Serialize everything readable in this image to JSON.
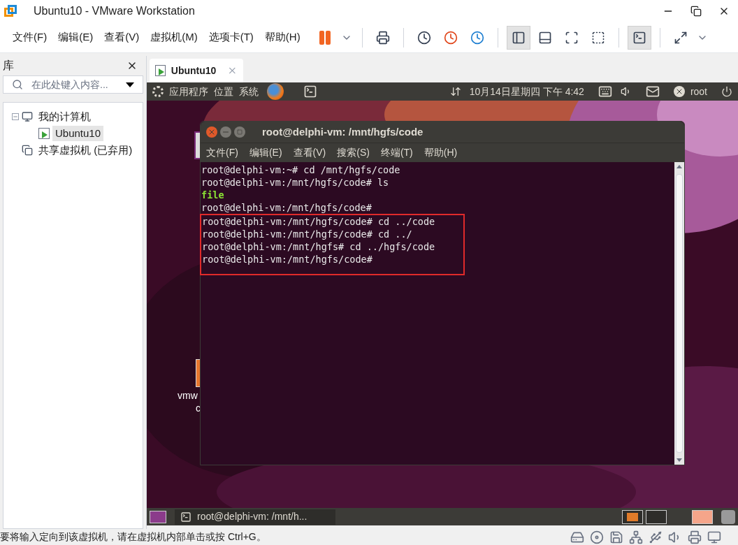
{
  "window": {
    "title": "Ubuntu10 - VMware Workstation"
  },
  "menu": [
    "文件(F)",
    "编辑(E)",
    "查看(V)",
    "虚拟机(M)",
    "选项卡(T)",
    "帮助(H)"
  ],
  "toolbar": [
    {
      "kind": "pause",
      "pressed": false
    },
    {
      "kind": "dropdown",
      "pressed": false
    },
    {
      "kind": "sep"
    },
    {
      "kind": "send-keys",
      "pressed": false
    },
    {
      "kind": "sep"
    },
    {
      "kind": "snapshot-take",
      "pressed": false
    },
    {
      "kind": "snapshot-revert",
      "pressed": false
    },
    {
      "kind": "snapshot-manage",
      "pressed": false
    },
    {
      "kind": "sep"
    },
    {
      "kind": "library",
      "pressed": true
    },
    {
      "kind": "thumbnails",
      "pressed": false
    },
    {
      "kind": "fullscreen",
      "pressed": false
    },
    {
      "kind": "unity",
      "pressed": false
    },
    {
      "kind": "sep"
    },
    {
      "kind": "console",
      "pressed": true
    },
    {
      "kind": "sep"
    },
    {
      "kind": "stretch",
      "pressed": false
    },
    {
      "kind": "dropdown",
      "pressed": false
    }
  ],
  "library": {
    "title": "库",
    "search": {
      "placeholder": "在此处键入内容..."
    },
    "tree": [
      {
        "label": "我的计算机",
        "kind": "computer",
        "expanded": true,
        "selected": false,
        "children": [
          {
            "label": "Ubuntu10",
            "kind": "vm",
            "selected": true
          }
        ]
      },
      {
        "label": "共享虚拟机 (已弃用)",
        "kind": "shared",
        "selected": false
      }
    ]
  },
  "tabs": [
    {
      "label": "Ubuntu10",
      "selected": true
    }
  ],
  "guest": {
    "top_panel": {
      "menus": [
        "应用程序",
        "位置",
        "系统"
      ],
      "clock": "10月14日星期四 下午 4:42",
      "user": "root"
    },
    "desktop_labels": [
      "vmw",
      "c"
    ],
    "terminal": {
      "title": "root@delphi-vm: /mnt/hgfs/code",
      "menus": [
        "文件(F)",
        "编辑(E)",
        "查看(V)",
        "搜索(S)",
        "终端(T)",
        "帮助(H)"
      ],
      "lines": [
        {
          "text": "root@delphi-vm:~# cd /mnt/hgfs/code",
          "kind": "output",
          "highlighted": false
        },
        {
          "text": "root@delphi-vm:/mnt/hgfs/code# ls",
          "kind": "output",
          "highlighted": false
        },
        {
          "text": "file",
          "kind": "directory",
          "highlighted": false
        },
        {
          "text": "root@delphi-vm:/mnt/hgfs/code#",
          "kind": "output",
          "highlighted": false
        },
        {
          "text": "root@delphi-vm:/mnt/hgfs/code# cd ../code",
          "kind": "output",
          "highlighted": true
        },
        {
          "text": "root@delphi-vm:/mnt/hgfs/code# cd ../",
          "kind": "output",
          "highlighted": true
        },
        {
          "text": "root@delphi-vm:/mnt/hgfs# cd ../hgfs/code",
          "kind": "output",
          "highlighted": true
        },
        {
          "text": "root@delphi-vm:/mnt/hgfs/code#",
          "kind": "output",
          "highlighted": true
        }
      ]
    },
    "taskbar": [
      {
        "label": "root@delphi-vm: /mnt/h...",
        "selected": false
      }
    ]
  },
  "status_bar": {
    "text": "要将输入定向到该虚拟机，请在虚拟机内部单击或按 Ctrl+G。"
  }
}
